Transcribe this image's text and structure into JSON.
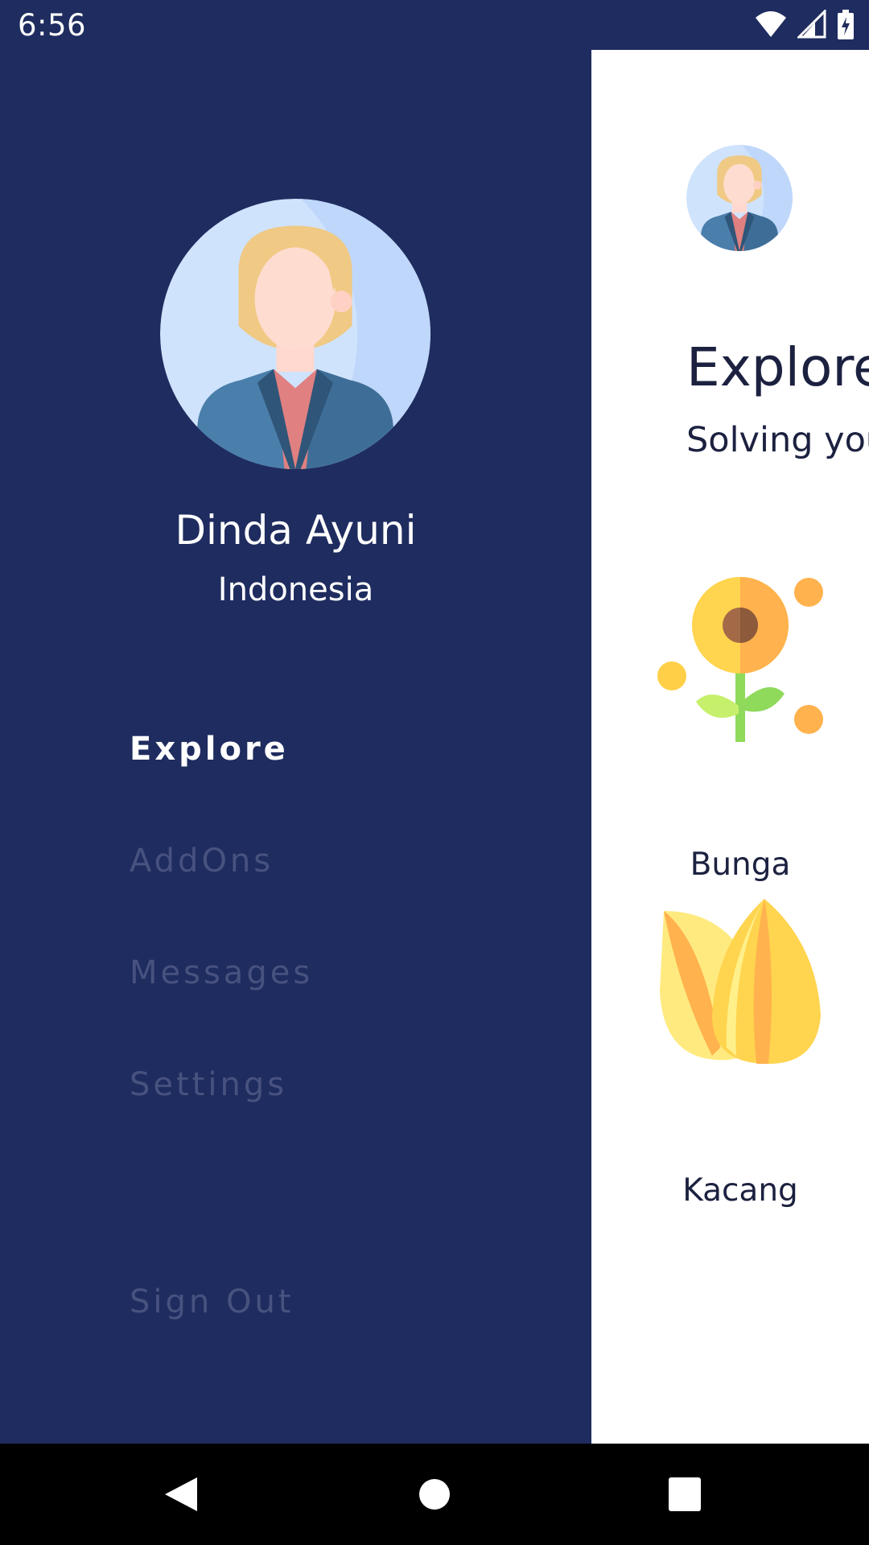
{
  "status_bar": {
    "time": "6:56",
    "icons": [
      "wifi-icon",
      "cellular-signal-icon",
      "battery-charging-icon"
    ]
  },
  "drawer": {
    "user": {
      "name": "Dinda Ayuni",
      "location": "Indonesia",
      "avatar_icon": "woman-avatar-icon"
    },
    "menu": [
      {
        "label": "Explore",
        "active": true
      },
      {
        "label": "AddOns",
        "active": false
      },
      {
        "label": "Messages",
        "active": false
      },
      {
        "label": "Settings",
        "active": false
      }
    ],
    "sign_out_label": "Sign Out"
  },
  "main": {
    "title": "Explore",
    "subtitle": "Solving you",
    "categories": [
      {
        "label": "Bunga",
        "icon": "sunflower-icon"
      },
      {
        "label": "Kacang",
        "icon": "seeds-icon"
      }
    ]
  },
  "nav_bar": {
    "buttons": [
      "back-icon",
      "home-icon",
      "recents-icon"
    ]
  },
  "colors": {
    "drawer_bg": "#1f2c5f",
    "menu_active": "#ffffff",
    "menu_inactive": "#47527f",
    "panel_bg": "#ffffff",
    "text_dark": "#1c2140"
  }
}
